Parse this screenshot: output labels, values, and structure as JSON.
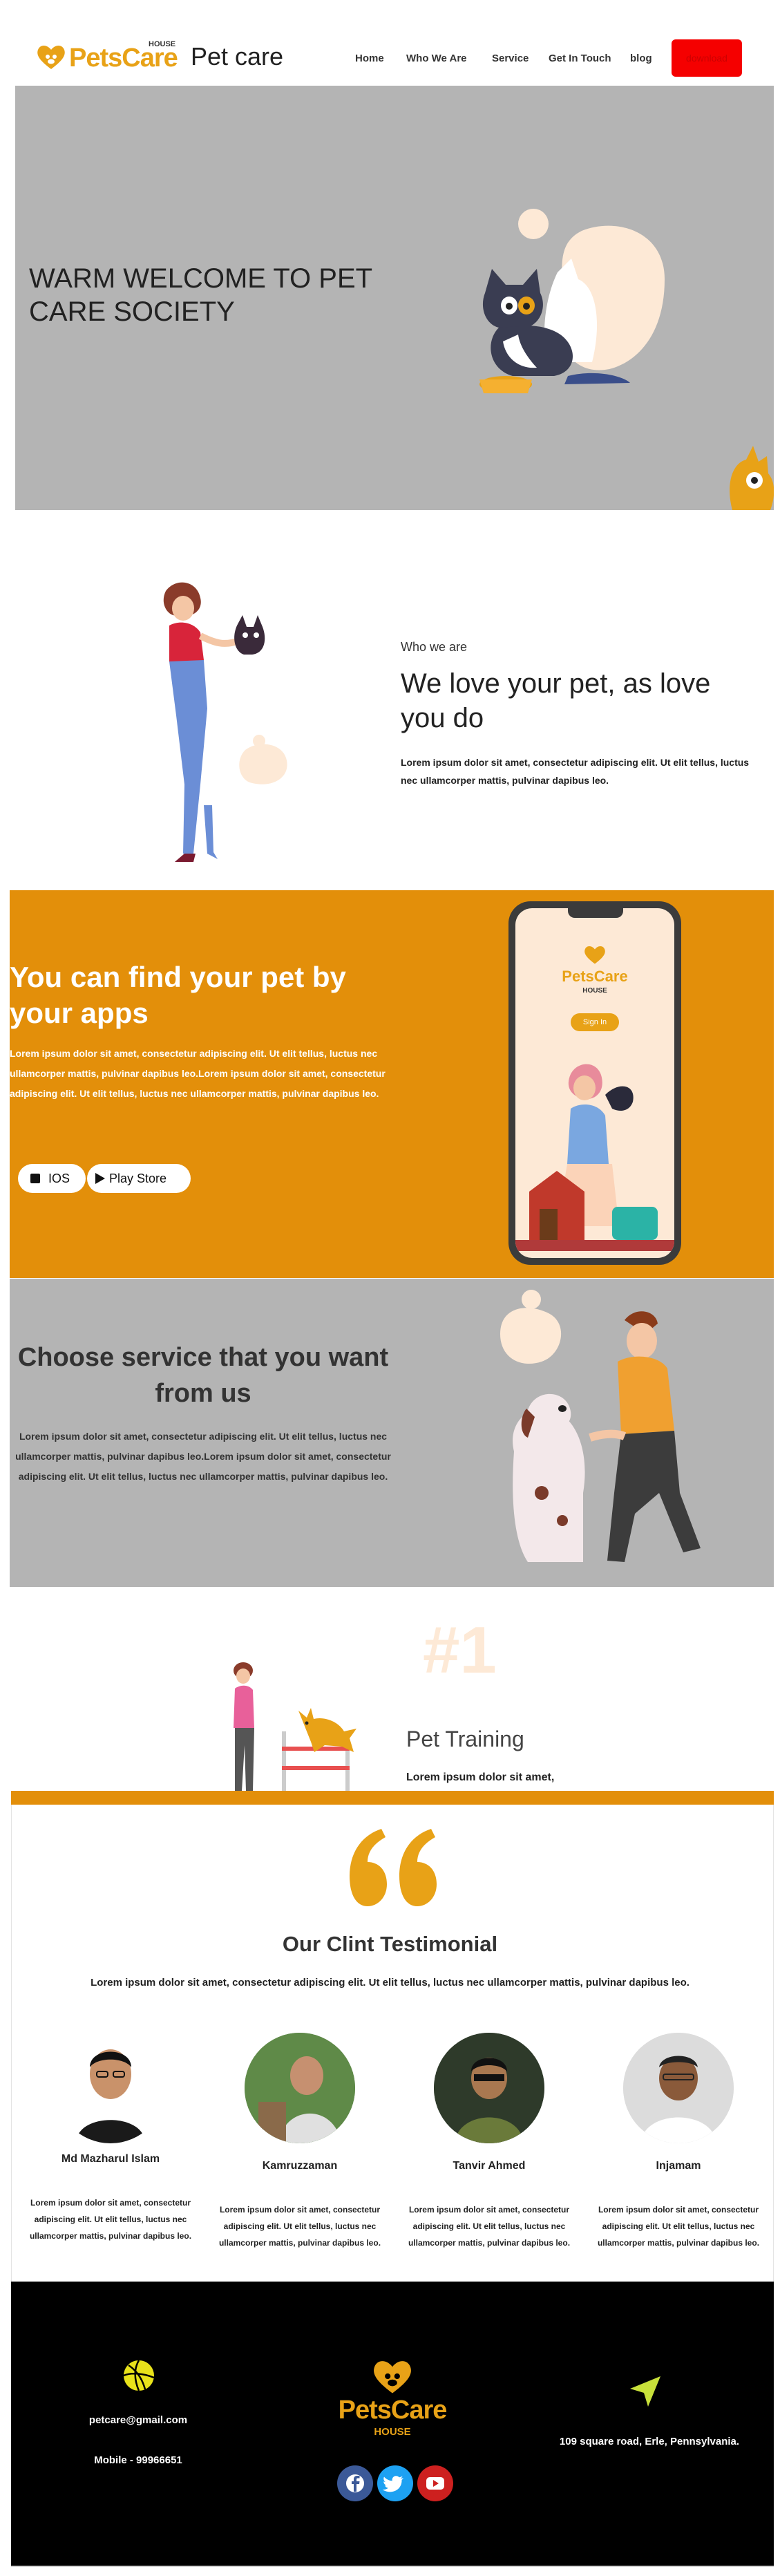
{
  "nav": {
    "logo_text": "PetsCare",
    "logo_sub": "HOUSE",
    "brand": "Pet care",
    "menu": [
      "Home",
      "Who We Are",
      "Service",
      "Get In Touch",
      "blog"
    ],
    "download_label": "download",
    "accent": "#e8a217",
    "download_color": "#f50000"
  },
  "hero": {
    "title": "WARM WELCOME TO PET CARE SOCIETY",
    "bg": "#b4b4b4"
  },
  "who": {
    "eyebrow": "Who we are",
    "title": "We love your pet, as love you do",
    "text": "Lorem ipsum dolor sit amet, consectetur adipiscing elit. Ut elit tellus, luctus nec ullamcorper mattis, pulvinar dapibus leo."
  },
  "apps": {
    "title": "You can find your pet by your apps",
    "text": "Lorem ipsum dolor sit amet, consectetur adipiscing elit. Ut elit tellus, luctus nec ullamcorper mattis, pulvinar dapibus leo.Lorem ipsum dolor sit amet, consectetur adipiscing elit. Ut elit tellus, luctus nec ullamcorper mattis, pulvinar dapibus leo.",
    "ios_label": "IOS",
    "play_label": "Play Store",
    "phone_logo": "PetsCare",
    "phone_logo_sub": "HOUSE",
    "phone_button": "Sign In",
    "bg": "#e38f0a"
  },
  "service": {
    "title": "Choose service that you want from us",
    "text": "Lorem ipsum dolor sit amet, consectetur adipiscing elit. Ut elit tellus, luctus nec ullamcorper mattis, pulvinar dapibus leo.Lorem ipsum dolor sit amet, consectetur adipiscing elit. Ut elit tellus, luctus nec ullamcorper mattis, pulvinar dapibus leo."
  },
  "training": {
    "rank": "#1",
    "title": "Pet Training",
    "text": "Lorem ipsum dolor sit amet,"
  },
  "testimonial": {
    "title": "Our Clint Testimonial",
    "subtitle": "Lorem ipsum dolor sit amet, consectetur adipiscing elit. Ut elit tellus, luctus nec ullamcorper mattis, pulvinar dapibus leo.",
    "people": [
      {
        "name": "Md Mazharul Islam",
        "text": "Lorem ipsum dolor sit amet, consectetur adipiscing elit. Ut elit tellus, luctus nec ullamcorper mattis, pulvinar dapibus leo."
      },
      {
        "name": "Kamruzzaman",
        "text": "Lorem ipsum dolor sit amet, consectetur adipiscing elit. Ut elit tellus, luctus nec ullamcorper mattis, pulvinar dapibus leo."
      },
      {
        "name": "Tanvir Ahmed",
        "text": "Lorem ipsum dolor sit amet, consectetur adipiscing elit. Ut elit tellus, luctus nec ullamcorper mattis, pulvinar dapibus leo."
      },
      {
        "name": "Injamam",
        "text": "Lorem ipsum dolor sit amet, consectetur adipiscing elit. Ut elit tellus, luctus nec ullamcorper mattis, pulvinar dapibus leo."
      }
    ]
  },
  "footer": {
    "email": "petcare@gmail.com",
    "mobile": "Mobile - 99966651",
    "address": "109 square road, Erle, Pennsylvania.",
    "logo_text": "PetsCare",
    "logo_sub": "HOUSE",
    "social": [
      "facebook-icon",
      "twitter-icon",
      "youtube-icon"
    ]
  }
}
